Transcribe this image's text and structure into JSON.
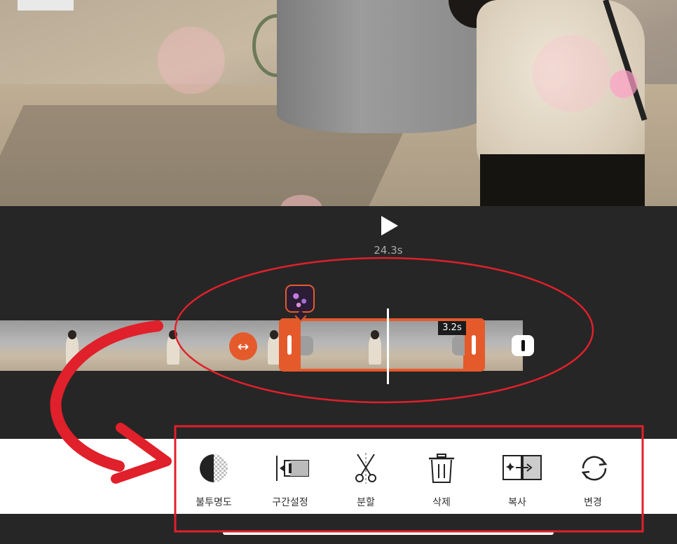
{
  "player": {
    "duration": "24.3s",
    "play_icon": "play-icon"
  },
  "timeline": {
    "selected_clip_duration": "3.2s",
    "sticker_icon": "bokeh-sticker-icon",
    "move_icon": "left-right-arrow-icon",
    "accent_color": "#e55a2b"
  },
  "toolbar": {
    "items": [
      {
        "label": "불투명도",
        "icon": "opacity-icon"
      },
      {
        "label": "구간설정",
        "icon": "range-set-icon"
      },
      {
        "label": "분할",
        "icon": "split-scissors-icon"
      },
      {
        "label": "삭제",
        "icon": "trash-icon"
      },
      {
        "label": "복사",
        "icon": "duplicate-icon"
      },
      {
        "label": "변경",
        "icon": "replace-icon"
      }
    ]
  },
  "annotations": {
    "color": "#e0202a"
  }
}
